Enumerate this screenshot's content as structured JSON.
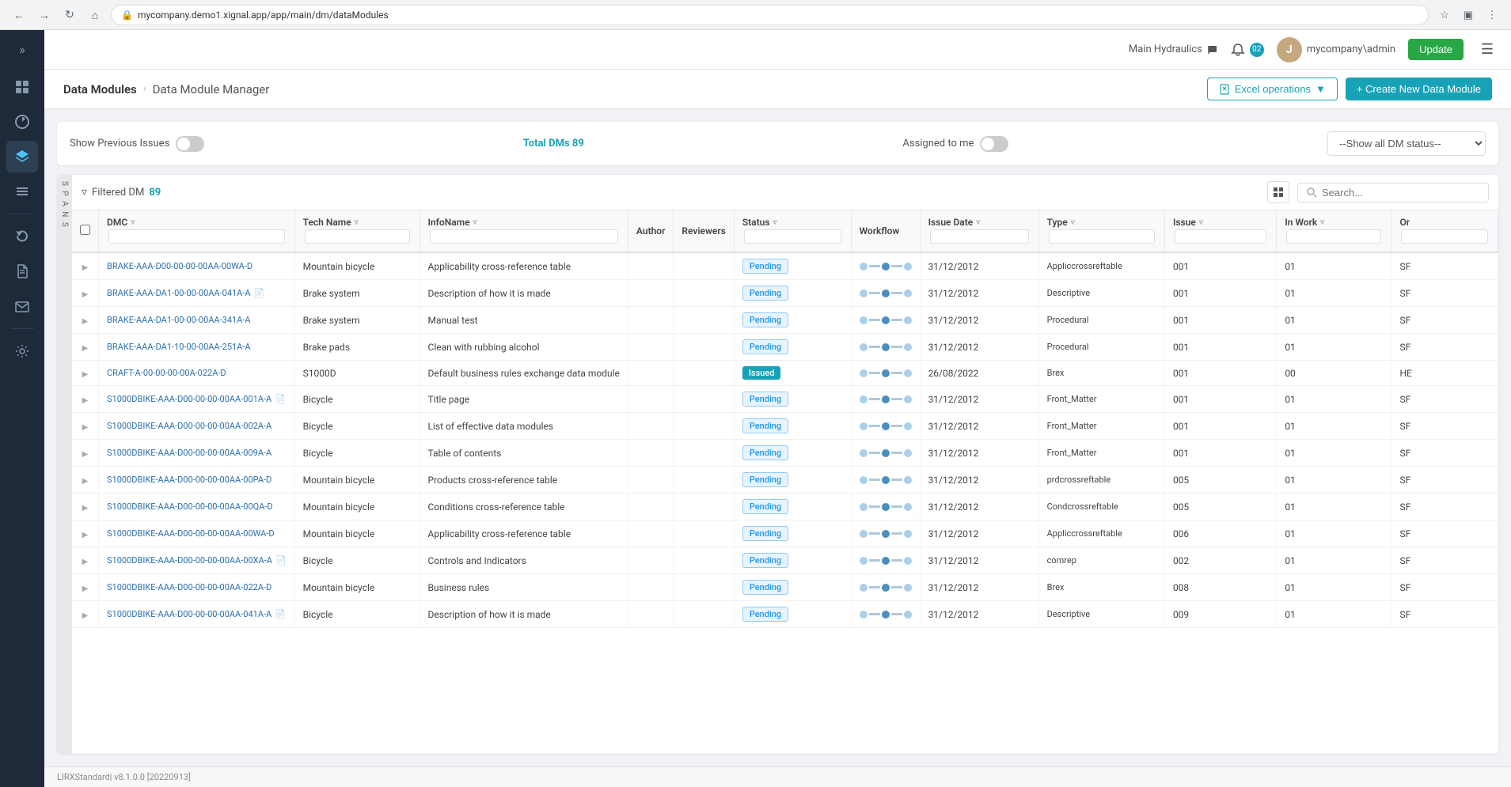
{
  "browser": {
    "url": "mycompany.demo1.xignal.app/app/main/dm/dataModules",
    "url_display": "mycompany.demo1.xignal.app/app/main/dm/dataModules"
  },
  "navbar": {
    "workspace": "Main Hydraulics",
    "username": "mycompany\\admin",
    "notification_count": "02",
    "update_label": "Update"
  },
  "page": {
    "title": "Data Modules",
    "breadcrumb": "Data Module Manager",
    "excel_btn": "Excel operations",
    "create_btn": "+ Create New Data Module"
  },
  "filter_bar": {
    "show_previous_label": "Show Previous Issues",
    "total_label": "Total DMs",
    "total_count": "89",
    "assigned_label": "Assigned to me",
    "status_placeholder": "--Show all DM status--"
  },
  "table": {
    "filter_label": "Filtered DM",
    "filter_count": "89",
    "search_placeholder": "Search...",
    "columns": [
      "DMC",
      "Tech Name",
      "InfoName",
      "Author",
      "Reviewers",
      "Status",
      "Workflow",
      "Issue Date",
      "Type",
      "Issue",
      "In Work",
      "Or"
    ],
    "rows": [
      {
        "dmc": "BRAKE-AAA-D00-00-00-00AA-00WA-D",
        "tech_name": "Mountain bicycle",
        "info_name": "Applicability cross-reference table",
        "author": "",
        "reviewers": "",
        "status": "Pending",
        "status_type": "pending",
        "issue_date": "31/12/2012",
        "type": "Appliccrossreftable",
        "issue": "001",
        "in_work": "01",
        "or": "SF",
        "has_icon": false
      },
      {
        "dmc": "BRAKE-AAA-DA1-00-00-00AA-041A-A",
        "tech_name": "Brake system",
        "info_name": "Description of how it is made",
        "author": "",
        "reviewers": "",
        "status": "Pending",
        "status_type": "pending",
        "issue_date": "31/12/2012",
        "type": "Descriptive",
        "issue": "001",
        "in_work": "01",
        "or": "SF",
        "has_icon": true
      },
      {
        "dmc": "BRAKE-AAA-DA1-00-00-00AA-341A-A",
        "tech_name": "Brake system",
        "info_name": "Manual test",
        "author": "",
        "reviewers": "",
        "status": "Pending",
        "status_type": "pending",
        "issue_date": "31/12/2012",
        "type": "Procedural",
        "issue": "001",
        "in_work": "01",
        "or": "SF",
        "has_icon": false
      },
      {
        "dmc": "BRAKE-AAA-DA1-10-00-00AA-251A-A",
        "tech_name": "Brake pads",
        "info_name": "Clean with rubbing alcohol",
        "author": "",
        "reviewers": "",
        "status": "Pending",
        "status_type": "pending",
        "issue_date": "31/12/2012",
        "type": "Procedural",
        "issue": "001",
        "in_work": "01",
        "or": "SF",
        "has_icon": false
      },
      {
        "dmc": "CRAFT-A-00-00-00-00A-022A-D",
        "tech_name": "S1000D",
        "info_name": "Default business rules exchange data module",
        "author": "",
        "reviewers": "",
        "status": "Issued",
        "status_type": "issued",
        "issue_date": "26/08/2022",
        "type": "Brex",
        "issue": "001",
        "in_work": "00",
        "or": "HE",
        "has_icon": false
      },
      {
        "dmc": "S1000DBIKE-AAA-D00-00-00-00AA-001A-A",
        "tech_name": "Bicycle",
        "info_name": "Title page",
        "author": "",
        "reviewers": "",
        "status": "Pending",
        "status_type": "pending",
        "issue_date": "31/12/2012",
        "type": "Front_Matter",
        "issue": "001",
        "in_work": "01",
        "or": "SF",
        "has_icon": true
      },
      {
        "dmc": "S1000DBIKE-AAA-D00-00-00-00AA-002A-A",
        "tech_name": "Bicycle",
        "info_name": "List of effective data modules",
        "author": "",
        "reviewers": "",
        "status": "Pending",
        "status_type": "pending",
        "issue_date": "31/12/2012",
        "type": "Front_Matter",
        "issue": "001",
        "in_work": "01",
        "or": "SF",
        "has_icon": false
      },
      {
        "dmc": "S1000DBIKE-AAA-D00-00-00-00AA-009A-A",
        "tech_name": "Bicycle",
        "info_name": "Table of contents",
        "author": "",
        "reviewers": "",
        "status": "Pending",
        "status_type": "pending",
        "issue_date": "31/12/2012",
        "type": "Front_Matter",
        "issue": "001",
        "in_work": "01",
        "or": "SF",
        "has_icon": false
      },
      {
        "dmc": "S1000DBIKE-AAA-D00-00-00-00AA-00PA-D",
        "tech_name": "Mountain bicycle",
        "info_name": "Products cross-reference table",
        "author": "",
        "reviewers": "",
        "status": "Pending",
        "status_type": "pending",
        "issue_date": "31/12/2012",
        "type": "prdcrossreftable",
        "issue": "005",
        "in_work": "01",
        "or": "SF",
        "has_icon": false
      },
      {
        "dmc": "S1000DBIKE-AAA-D00-00-00-00AA-00QA-D",
        "tech_name": "Mountain bicycle",
        "info_name": "Conditions cross-reference table",
        "author": "",
        "reviewers": "",
        "status": "Pending",
        "status_type": "pending",
        "issue_date": "31/12/2012",
        "type": "Condcrossreftable",
        "issue": "005",
        "in_work": "01",
        "or": "SF",
        "has_icon": false
      },
      {
        "dmc": "S1000DBIKE-AAA-D00-00-00-00AA-00WA-D",
        "tech_name": "Mountain bicycle",
        "info_name": "Applicability cross-reference table",
        "author": "",
        "reviewers": "",
        "status": "Pending",
        "status_type": "pending",
        "issue_date": "31/12/2012",
        "type": "Appliccrossreftable",
        "issue": "006",
        "in_work": "01",
        "or": "SF",
        "has_icon": false
      },
      {
        "dmc": "S1000DBIKE-AAA-D00-00-00-00AA-00XA-A",
        "tech_name": "Bicycle",
        "info_name": "Controls and Indicators",
        "author": "",
        "reviewers": "",
        "status": "Pending",
        "status_type": "pending",
        "issue_date": "31/12/2012",
        "type": "comrep",
        "issue": "002",
        "in_work": "01",
        "or": "SF",
        "has_icon": true
      },
      {
        "dmc": "S1000DBIKE-AAA-D00-00-00-00AA-022A-D",
        "tech_name": "Mountain bicycle",
        "info_name": "Business rules",
        "author": "",
        "reviewers": "",
        "status": "Pending",
        "status_type": "pending",
        "issue_date": "31/12/2012",
        "type": "Brex",
        "issue": "008",
        "in_work": "01",
        "or": "SF",
        "has_icon": false
      },
      {
        "dmc": "S1000DBIKE-AAA-D00-00-00-00AA-041A-A",
        "tech_name": "Bicycle",
        "info_name": "Description of how it is made",
        "author": "",
        "reviewers": "",
        "status": "Pending",
        "status_type": "pending",
        "issue_date": "31/12/2012",
        "type": "Descriptive",
        "issue": "009",
        "in_work": "01",
        "or": "SF",
        "has_icon": true
      }
    ]
  },
  "footer": {
    "version": "LIRXStandard| v8.1.0.0 [20220913]"
  },
  "sidebar": {
    "icons": [
      "dashboard",
      "analytics",
      "layers",
      "list",
      "refresh",
      "document",
      "mail",
      "settings"
    ]
  },
  "panel": {
    "label": "S\nP\nA\nN\nS"
  }
}
